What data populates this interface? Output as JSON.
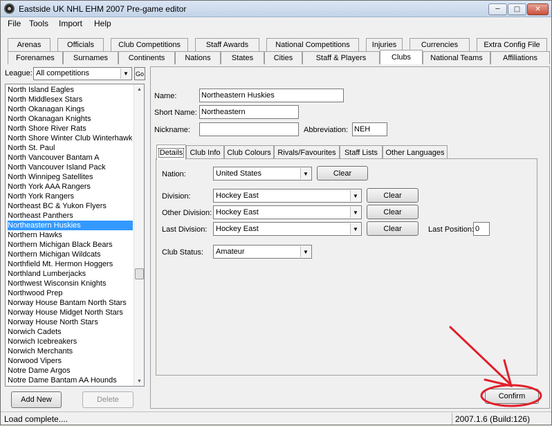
{
  "window": {
    "title": "Eastside UK NHL EHM 2007 Pre-game editor"
  },
  "menu": [
    "File",
    "Tools",
    "Import",
    "Help"
  ],
  "tabs_row1": [
    "Arenas",
    "Officials",
    "Club Competitions",
    "Staff Awards",
    "National Competitions",
    "Injuries",
    "Currencies",
    "Extra Config File"
  ],
  "tabs_row2": [
    "Forenames",
    "Surnames",
    "Continents",
    "Nations",
    "States",
    "Cities",
    "Staff & Players",
    "Clubs",
    "National Teams",
    "Affiliations"
  ],
  "active_tab": "Clubs",
  "league": {
    "label": "League:",
    "value": "All competitions",
    "go_label": "Go"
  },
  "clubs": [
    "North Island Eagles",
    "North Middlesex Stars",
    "North Okanagan Kings",
    "North Okanagan Knights",
    "North Shore River Rats",
    "North Shore Winter Club Winterhawks",
    "North St. Paul",
    "North Vancouver Bantam A",
    "North Vancouver Island Pack",
    "North Winnipeg Satellites",
    "North York AAA Rangers",
    "North York Rangers",
    "Northeast BC & Yukon Flyers",
    "Northeast Panthers",
    "Northeastern Huskies",
    "Northern Hawks",
    "Northern Michigan Black Bears",
    "Northern Michigan Wildcats",
    "Northfield Mt. Hermon Hoggers",
    "Northland Lumberjacks",
    "Northwest Wisconsin Knights",
    "Northwood Prep",
    "Norway House Bantam North Stars",
    "Norway House Midget North Stars",
    "Norway House North Stars",
    "Norwich Cadets",
    "Norwich Icebreakers",
    "Norwich Merchants",
    "Norwood Vipers",
    "Notre Dame Argos",
    "Notre Dame Bantam AA Hounds"
  ],
  "selected_club": "Northeastern Huskies",
  "buttons": {
    "add_new": "Add New",
    "delete": "Delete",
    "confirm": "Confirm",
    "clear": "Clear"
  },
  "form": {
    "name_label": "Name:",
    "name": "Northeastern Huskies",
    "short_name_label": "Short Name:",
    "short_name": "Northeastern",
    "nickname_label": "Nickname:",
    "nickname": "",
    "abbreviation_label": "Abbreviation:",
    "abbreviation": "NEH"
  },
  "inner_tabs": [
    "Details",
    "Club Info",
    "Club Colours",
    "Rivals/Favourites",
    "Staff Lists",
    "Other Languages"
  ],
  "details": {
    "nation_label": "Nation:",
    "nation": "United States",
    "division_label": "Division:",
    "division": "Hockey East",
    "other_division_label": "Other Division:",
    "other_division": "Hockey East",
    "last_division_label": "Last Division:",
    "last_division": "Hockey East",
    "last_position_label": "Last Position:",
    "last_position": "0",
    "club_status_label": "Club Status:",
    "club_status": "Amateur"
  },
  "status": {
    "left": "Load complete....",
    "right": "2007.1.6 (Build:126)"
  },
  "colors": {
    "selection": "#3399ff",
    "annotation": "#e0202a"
  },
  "icons": [
    "app-icon",
    "minimize-icon",
    "maximize-icon",
    "close-icon",
    "chevron-down-icon"
  ]
}
